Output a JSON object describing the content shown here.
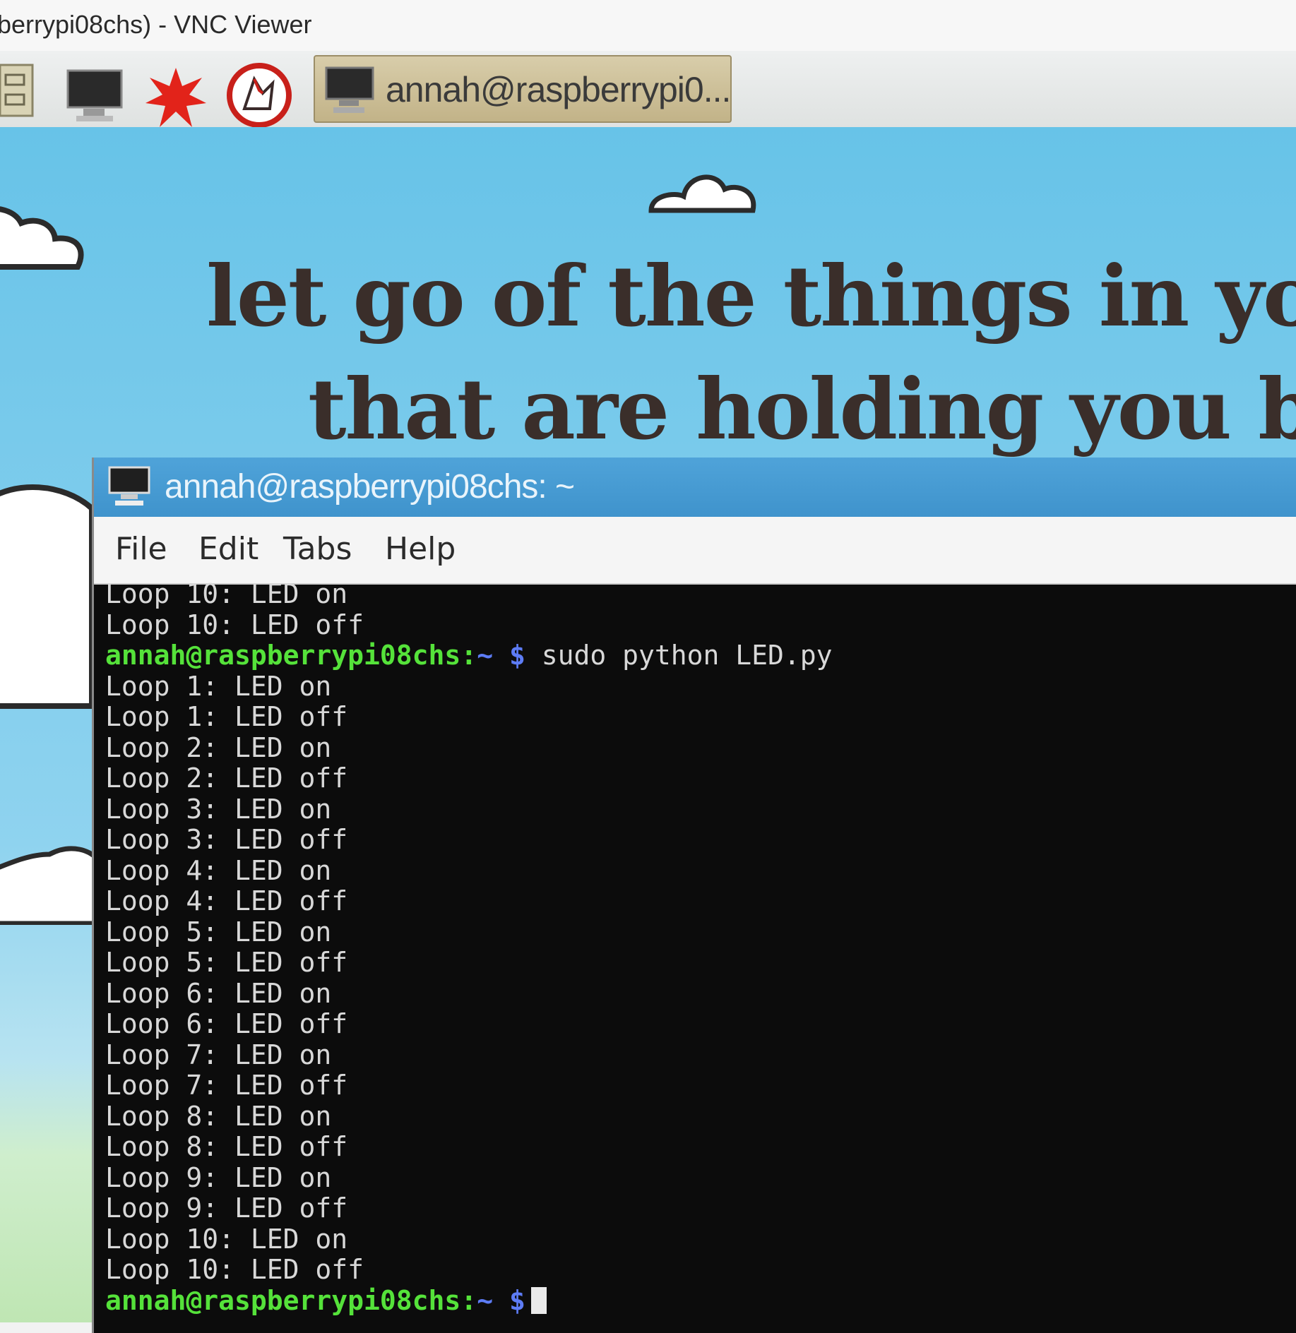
{
  "vnc": {
    "title": "berrypi08chs) - VNC Viewer"
  },
  "taskbar": {
    "icons": [
      "file-manager-icon",
      "terminal-icon",
      "wolfram-icon",
      "mathematica-icon"
    ],
    "task_label": "annah@raspberrypi0..."
  },
  "wallpaper": {
    "line1": "let go of the things in your li",
    "line2": "that are holding you back"
  },
  "terminal": {
    "title": "annah@raspberrypi08chs: ~",
    "menu": [
      "File",
      "Edit",
      "Tabs",
      "Help"
    ],
    "lines": [
      {
        "type": "output",
        "text": "Loop 10: LED on"
      },
      {
        "type": "output",
        "text": "Loop 10: LED off"
      },
      {
        "type": "prompt",
        "user": "annah@raspberrypi08chs:",
        "path": "~ $",
        "cmd": " sudo python LED.py"
      },
      {
        "type": "output",
        "text": "Loop 1: LED on"
      },
      {
        "type": "output",
        "text": "Loop 1: LED off"
      },
      {
        "type": "output",
        "text": "Loop 2: LED on"
      },
      {
        "type": "output",
        "text": "Loop 2: LED off"
      },
      {
        "type": "output",
        "text": "Loop 3: LED on"
      },
      {
        "type": "output",
        "text": "Loop 3: LED off"
      },
      {
        "type": "output",
        "text": "Loop 4: LED on"
      },
      {
        "type": "output",
        "text": "Loop 4: LED off"
      },
      {
        "type": "output",
        "text": "Loop 5: LED on"
      },
      {
        "type": "output",
        "text": "Loop 5: LED off"
      },
      {
        "type": "output",
        "text": "Loop 6: LED on"
      },
      {
        "type": "output",
        "text": "Loop 6: LED off"
      },
      {
        "type": "output",
        "text": "Loop 7: LED on"
      },
      {
        "type": "output",
        "text": "Loop 7: LED off"
      },
      {
        "type": "output",
        "text": "Loop 8: LED on"
      },
      {
        "type": "output",
        "text": "Loop 8: LED off"
      },
      {
        "type": "output",
        "text": "Loop 9: LED on"
      },
      {
        "type": "output",
        "text": "Loop 9: LED off"
      },
      {
        "type": "output",
        "text": "Loop 10: LED on"
      },
      {
        "type": "output",
        "text": "Loop 10: LED off"
      },
      {
        "type": "prompt",
        "user": "annah@raspberrypi08chs:",
        "path": "~ $",
        "cmd": "",
        "cursor": true
      }
    ]
  }
}
